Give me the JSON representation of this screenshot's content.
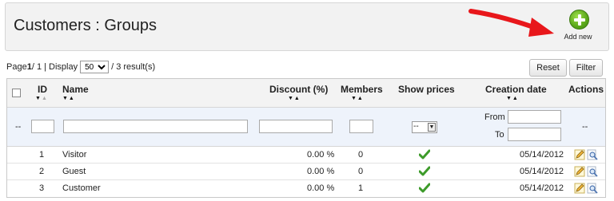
{
  "page": {
    "title": "Customers : Groups",
    "add_new_label": "Add new"
  },
  "pager": {
    "page_label": "Page ",
    "current_page": "1",
    "of_label": " / 1 | Display ",
    "per_page": "50",
    "results_label": " / 3 result(s)"
  },
  "buttons": {
    "reset": "Reset",
    "filter": "Filter"
  },
  "columns": {
    "id": "ID",
    "name": "Name",
    "discount": "Discount (%)",
    "members": "Members",
    "show_prices": "Show prices",
    "creation_date": "Creation date",
    "actions": "Actions"
  },
  "filters": {
    "empty_marker": "--",
    "show_prices_value": "--",
    "from_label": "From",
    "to_label": "To",
    "actions_marker": "--"
  },
  "rows": [
    {
      "id": "1",
      "name": "Visitor",
      "discount": "0.00 %",
      "members": "0",
      "show_prices": true,
      "date": "05/14/2012"
    },
    {
      "id": "2",
      "name": "Guest",
      "discount": "0.00 %",
      "members": "0",
      "show_prices": true,
      "date": "05/14/2012"
    },
    {
      "id": "3",
      "name": "Customer",
      "discount": "0.00 %",
      "members": "1",
      "show_prices": true,
      "date": "05/14/2012"
    }
  ],
  "icons": {
    "add": "plus-circle-icon",
    "annotation": "red-arrow-icon",
    "show_prices": "checkmark-icon",
    "edit": "pencil-icon",
    "view": "magnifier-icon",
    "dropdown": "chevron-down-icon"
  },
  "colors": {
    "add_button": "#5aa71a",
    "arrow": "#e8171b",
    "check": "#3d9b2a",
    "filter_row_bg": "#eef3fb"
  }
}
